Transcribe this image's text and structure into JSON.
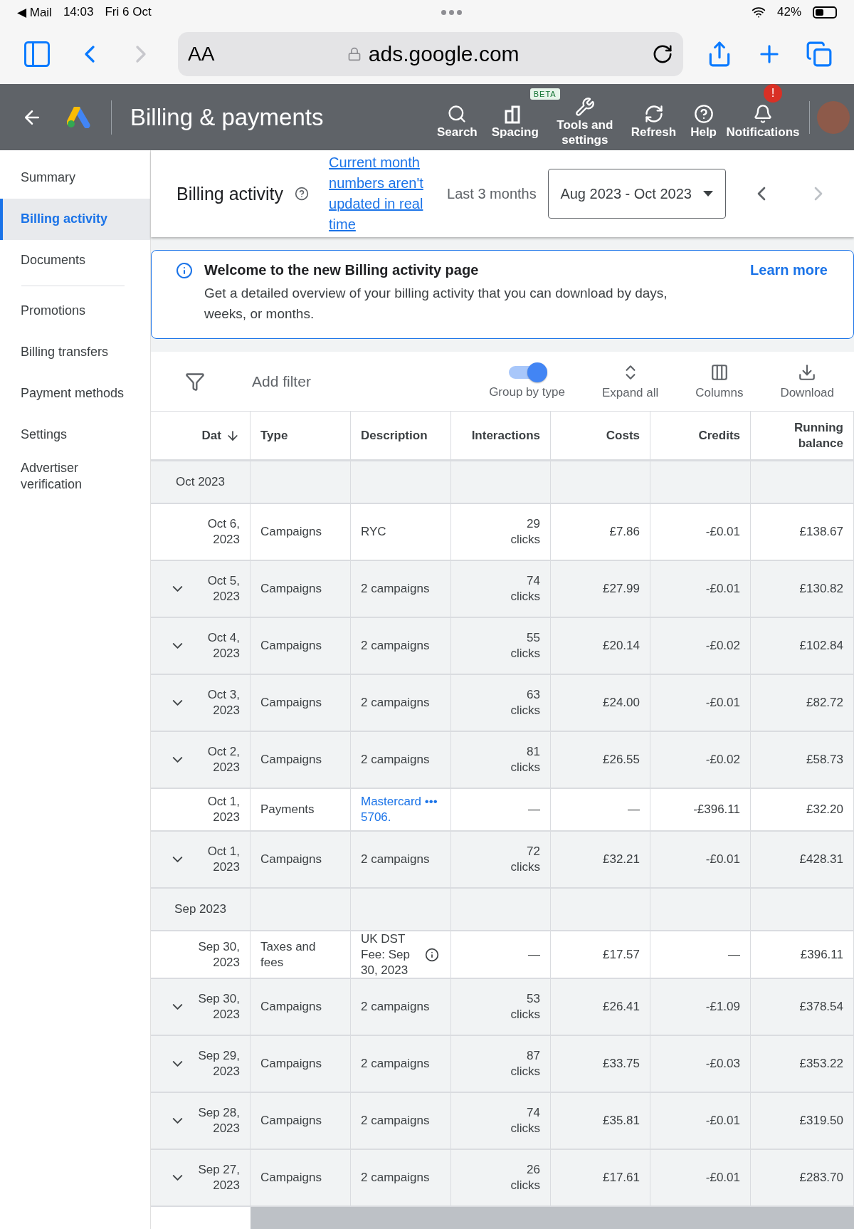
{
  "status_bar": {
    "back_app": "◀ Mail",
    "time": "14:03",
    "date": "Fri 6 Oct",
    "battery": "42%"
  },
  "browser": {
    "text_size": "AA",
    "url": "ads.google.com"
  },
  "header": {
    "title": "Billing & payments",
    "actions": [
      {
        "kind": "search",
        "label": "Search"
      },
      {
        "kind": "spacing",
        "label": "Spacing",
        "badge": "BETA"
      },
      {
        "kind": "tools",
        "label": "Tools and settings"
      },
      {
        "kind": "refresh",
        "label": "Refresh"
      },
      {
        "kind": "help",
        "label": "Help"
      },
      {
        "kind": "notifications",
        "label": "Notifications",
        "badge": "!"
      }
    ]
  },
  "sidebar": {
    "groups": [
      [
        {
          "label": "Summary",
          "selected": false
        },
        {
          "label": "Billing activity",
          "selected": true
        },
        {
          "label": "Documents",
          "selected": false
        }
      ],
      [
        {
          "label": "Promotions",
          "selected": false
        },
        {
          "label": "Billing transfers",
          "selected": false
        },
        {
          "label": "Payment methods",
          "selected": false
        },
        {
          "label": "Settings",
          "selected": false
        },
        {
          "label": "Advertiser verification",
          "selected": false
        }
      ]
    ]
  },
  "page_header": {
    "title": "Billing activity",
    "notice_link": "Current month numbers aren't updated in real time",
    "range_label": "Last 3 months",
    "range": "Aug 2023 - Oct 2023"
  },
  "banner": {
    "title": "Welcome to the new Billing activity page",
    "body": "Get a detailed overview of your billing activity that you can download by days, weeks, or months.",
    "link": "Learn more"
  },
  "toolbar": {
    "filter": "Add filter",
    "group_by_type": {
      "label": "Group by type",
      "on": true
    },
    "actions": [
      {
        "kind": "expand",
        "label": "Expand all"
      },
      {
        "kind": "columns",
        "label": "Columns"
      },
      {
        "kind": "download",
        "label": "Download"
      }
    ]
  },
  "table": {
    "columns": [
      "Dat",
      "Type",
      "Description",
      "Interactions",
      "Costs",
      "Credits",
      "Running balance"
    ],
    "rows": [
      {
        "kind": "group",
        "label": "Oct 2023"
      },
      {
        "kind": "entry",
        "expandable": false,
        "date": "Oct 6, 2023",
        "type": "Campaigns",
        "description": "RYC",
        "interactions": "29 clicks",
        "costs": "£7.86",
        "credits": "-£0.01",
        "balance": "£138.67"
      },
      {
        "kind": "entry",
        "expandable": true,
        "date": "Oct 5, 2023",
        "type": "Campaigns",
        "description": "2 campaigns",
        "interactions": "74 clicks",
        "costs": "£27.99",
        "credits": "-£0.01",
        "balance": "£130.82"
      },
      {
        "kind": "entry",
        "expandable": true,
        "date": "Oct 4, 2023",
        "type": "Campaigns",
        "description": "2 campaigns",
        "interactions": "55 clicks",
        "costs": "£20.14",
        "credits": "-£0.02",
        "balance": "£102.84"
      },
      {
        "kind": "entry",
        "expandable": true,
        "date": "Oct 3, 2023",
        "type": "Campaigns",
        "description": "2 campaigns",
        "interactions": "63 clicks",
        "costs": "£24.00",
        "credits": "-£0.01",
        "balance": "£82.72"
      },
      {
        "kind": "entry",
        "expandable": true,
        "date": "Oct 2, 2023",
        "type": "Campaigns",
        "description": "2 campaigns",
        "interactions": "81 clicks",
        "costs": "£26.55",
        "credits": "-£0.02",
        "balance": "£58.73"
      },
      {
        "kind": "payment",
        "expandable": false,
        "date": "Oct 1, 2023",
        "type": "Payments",
        "description": "Mastercard ••• 5706.",
        "interactions": "—",
        "costs": "—",
        "credits": "-£396.11",
        "balance": "£32.20"
      },
      {
        "kind": "entry",
        "expandable": true,
        "date": "Oct 1, 2023",
        "type": "Campaigns",
        "description": "2 campaigns",
        "interactions": "72 clicks",
        "costs": "£32.21",
        "credits": "-£0.01",
        "balance": "£428.31"
      },
      {
        "kind": "group",
        "label": "Sep 2023"
      },
      {
        "kind": "fee",
        "expandable": false,
        "date": "Sep 30, 2023",
        "type": "Taxes and fees",
        "description": "UK DST Fee: Sep 30, 2023",
        "interactions": "—",
        "costs": "£17.57",
        "credits": "—",
        "balance": "£396.11"
      },
      {
        "kind": "entry",
        "expandable": true,
        "date": "Sep 30, 2023",
        "type": "Campaigns",
        "description": "2 campaigns",
        "interactions": "53 clicks",
        "costs": "£26.41",
        "credits": "-£1.09",
        "balance": "£378.54"
      },
      {
        "kind": "entry",
        "expandable": true,
        "date": "Sep 29, 2023",
        "type": "Campaigns",
        "description": "2 campaigns",
        "interactions": "87 clicks",
        "costs": "£33.75",
        "credits": "-£0.03",
        "balance": "£353.22"
      },
      {
        "kind": "entry",
        "expandable": true,
        "date": "Sep 28, 2023",
        "type": "Campaigns",
        "description": "2 campaigns",
        "interactions": "74 clicks",
        "costs": "£35.81",
        "credits": "-£0.01",
        "balance": "£319.50"
      },
      {
        "kind": "entry",
        "expandable": true,
        "date": "Sep 27, 2023",
        "type": "Campaigns",
        "description": "2 campaigns",
        "interactions": "26 clicks",
        "costs": "£17.61",
        "credits": "-£0.01",
        "balance": "£283.70"
      }
    ]
  }
}
